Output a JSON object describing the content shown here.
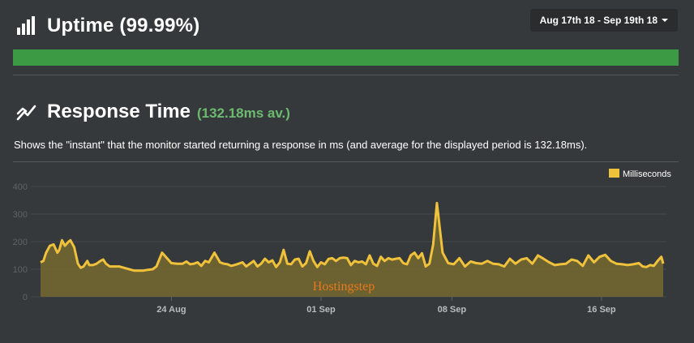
{
  "uptime": {
    "title": "Uptime (99.99%)",
    "icon": "bar-chart-icon",
    "bar_color": "#3c9a45",
    "percent": 99.99
  },
  "date_range": {
    "label": "Aug 17th 18 - Sep 19th 18",
    "icon": "caret-down-icon"
  },
  "response_time": {
    "title": "Response Time",
    "average": "(132.18ms av.)",
    "icon": "line-chart-icon",
    "description": "Shows the \"instant\" that the monitor started returning a response in ms (and average for the displayed period is 132.18ms).",
    "accent_color": "#6cba6f"
  },
  "watermark": "Hostingstep",
  "chart_data": {
    "type": "area",
    "line_color": "#f0c23b",
    "fill_color": "#76692f",
    "legend": {
      "label": "Milliseconds",
      "position": "top-right"
    },
    "ylim": [
      0,
      400
    ],
    "yticks": [
      0,
      100,
      200,
      300,
      400
    ],
    "xlim": [
      0,
      33.3
    ],
    "xticks": [
      {
        "x": 7,
        "label": "24 Aug"
      },
      {
        "x": 15,
        "label": "01 Sep"
      },
      {
        "x": 22,
        "label": "08 Sep"
      },
      {
        "x": 30,
        "label": "16 Sep"
      }
    ],
    "grid": true,
    "x": [
      0,
      0.15,
      0.3,
      0.5,
      0.7,
      0.9,
      1.0,
      1.15,
      1.3,
      1.5,
      1.6,
      1.8,
      2.0,
      2.15,
      2.3,
      2.5,
      2.6,
      2.8,
      3.0,
      3.2,
      3.35,
      3.5,
      3.7,
      3.85,
      4.0,
      4.2,
      5.0,
      5.5,
      5.75,
      6.0,
      6.2,
      6.5,
      7.0,
      7.3,
      7.6,
      7.8,
      8.0,
      8.2,
      8.4,
      8.6,
      8.8,
      9.0,
      9.3,
      9.6,
      9.8,
      10.0,
      10.2,
      10.5,
      10.8,
      11.0,
      11.2,
      11.4,
      11.6,
      11.8,
      12.0,
      12.2,
      12.4,
      12.6,
      12.8,
      13.0,
      13.2,
      13.4,
      13.6,
      13.8,
      14.0,
      14.2,
      14.4,
      14.6,
      14.8,
      15.0,
      15.2,
      15.4,
      15.6,
      15.8,
      16.0,
      16.2,
      16.4,
      16.6,
      16.8,
      17.0,
      17.2,
      17.4,
      17.6,
      17.8,
      18.0,
      18.2,
      18.4,
      18.6,
      18.8,
      19.0,
      19.2,
      19.4,
      19.6,
      19.8,
      20.0,
      20.2,
      20.4,
      20.6,
      20.8,
      21.0,
      21.2,
      21.5,
      21.8,
      22.1,
      22.4,
      22.7,
      23.0,
      23.3,
      23.6,
      23.9,
      24.2,
      24.5,
      24.8,
      25.1,
      25.4,
      25.7,
      26.0,
      26.3,
      26.6,
      26.9,
      27.2,
      27.5,
      27.8,
      28.1,
      28.4,
      28.7,
      29.0,
      29.3,
      29.6,
      29.9,
      30.2,
      30.5,
      30.8,
      31.1,
      31.4,
      31.7,
      32.0,
      32.2,
      32.4,
      32.6,
      32.8,
      33.0,
      33.2,
      33.3
    ],
    "y": [
      125,
      130,
      160,
      185,
      190,
      160,
      170,
      205,
      185,
      200,
      205,
      180,
      120,
      105,
      110,
      130,
      115,
      115,
      120,
      130,
      135,
      120,
      110,
      110,
      110,
      110,
      95,
      95,
      98,
      100,
      110,
      160,
      122,
      120,
      120,
      128,
      118,
      120,
      125,
      112,
      130,
      125,
      160,
      125,
      120,
      118,
      112,
      118,
      125,
      110,
      120,
      130,
      110,
      120,
      138,
      125,
      132,
      108,
      125,
      170,
      120,
      118,
      135,
      138,
      110,
      122,
      165,
      130,
      108,
      125,
      118,
      137,
      140,
      130,
      140,
      142,
      140,
      115,
      130,
      125,
      128,
      118,
      150,
      120,
      112,
      145,
      130,
      140,
      135,
      138,
      140,
      122,
      118,
      150,
      160,
      140,
      158,
      110,
      120,
      190,
      340,
      160,
      122,
      118,
      140,
      110,
      128,
      122,
      120,
      130,
      120,
      118,
      110,
      138,
      120,
      135,
      140,
      120,
      150,
      138,
      125,
      115,
      118,
      120,
      135,
      130,
      112,
      150,
      125,
      145,
      152,
      130,
      120,
      118,
      115,
      118,
      122,
      110,
      108,
      115,
      112,
      130,
      145,
      120,
      115,
      108
    ]
  }
}
